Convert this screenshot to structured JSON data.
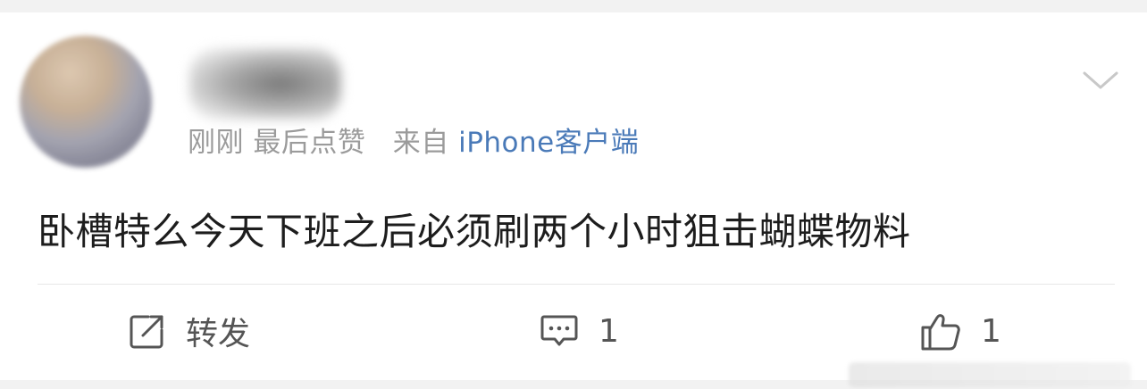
{
  "post": {
    "username": "",
    "meta": {
      "time": "刚刚",
      "liked_status": "最后点赞",
      "source_prefix": "来自",
      "source_name": "iPhone客户端"
    },
    "text": "卧槽特么今天下班之后必须刷两个小时狙击蝴蝶物料"
  },
  "actions": {
    "repost_label": "转发",
    "comment_count": "1",
    "like_count": "1"
  },
  "icons": {
    "menu": "chevron-down-icon",
    "repost": "repost-icon",
    "comment": "comment-icon",
    "like": "thumbs-up-icon"
  },
  "colors": {
    "link": "#4a7ab8",
    "meta_text": "#9b9b9b",
    "body_text": "#1d1d1d",
    "action_text": "#555555"
  }
}
